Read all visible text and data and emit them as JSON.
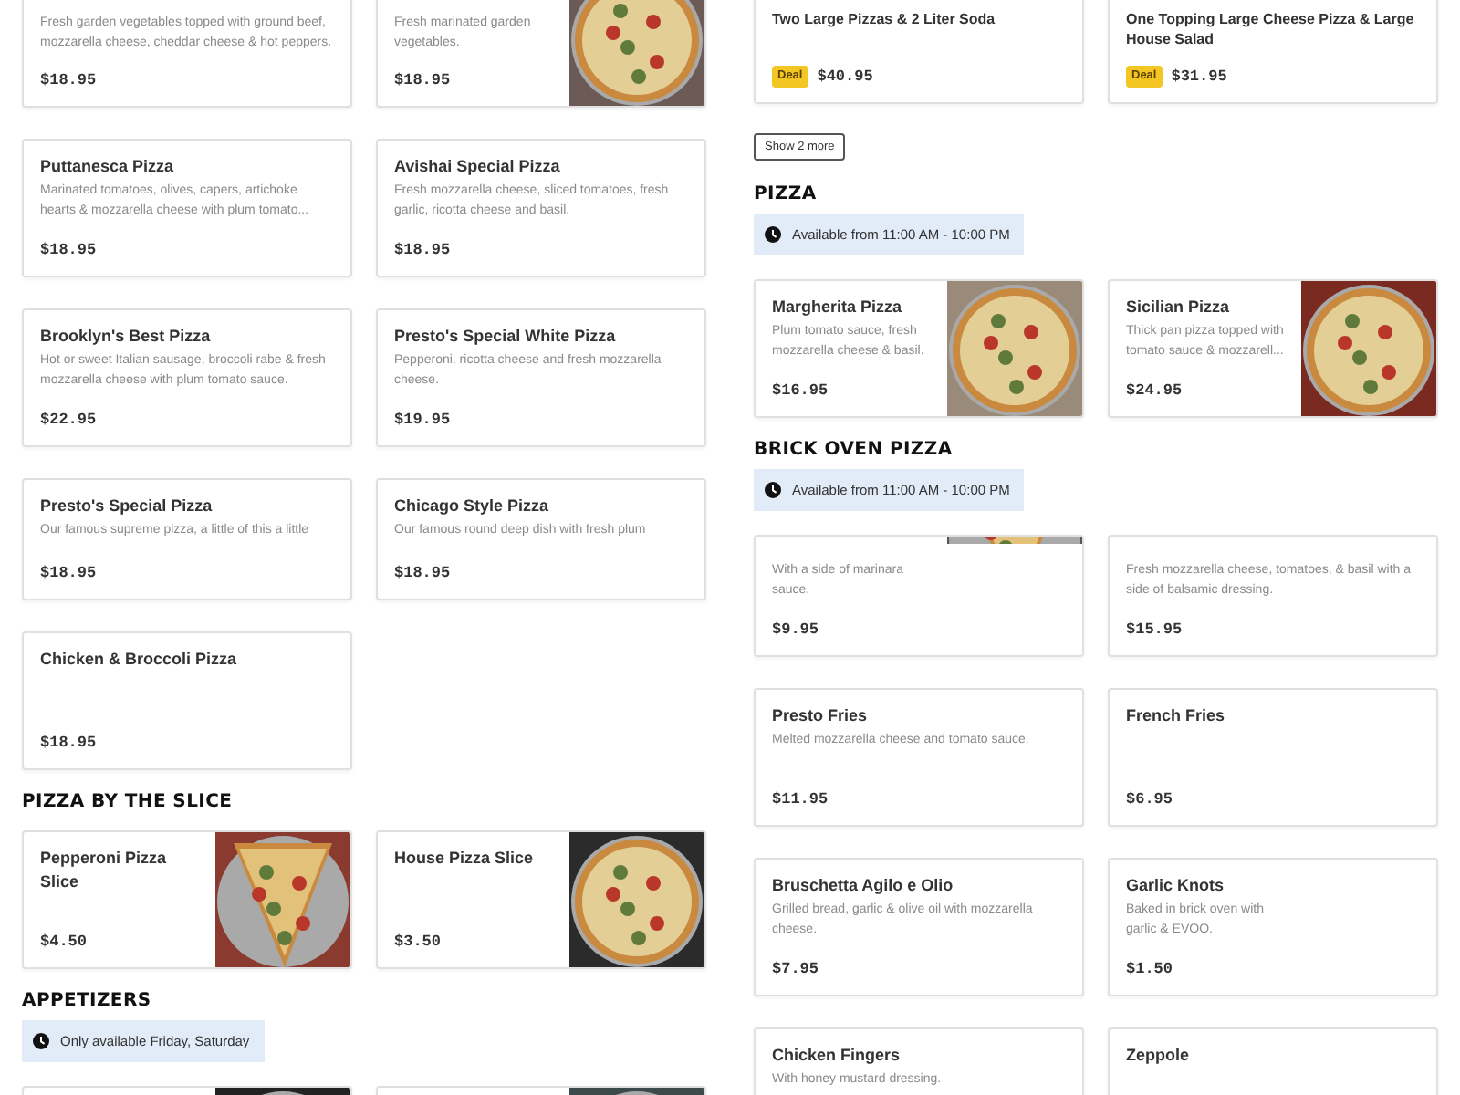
{
  "columns": [
    {
      "blocks": [
        {
          "kind": "top_cards",
          "items": [
            {
              "description": "Fresh garden vegetables topped with ground beef, mozzarella cheese, cheddar cheese & hot peppers.",
              "price": "$18.95"
            },
            {
              "description": "Fresh marinated garden vegetables.",
              "price": "$18.95"
            }
          ]
        },
        {
          "kind": "cards",
          "items": [
            {
              "title": "Puttanesca Pizza",
              "description": "Marinated tomatoes, olives, capers, artichoke hearts & mozzarella cheese with plum tomato...",
              "price": "$18.95"
            },
            {
              "title": "Avishai Special Pizza",
              "description": "Fresh mozzarella cheese, sliced tomatoes, fresh garlic, ricotta cheese and basil.",
              "price": "$18.95"
            }
          ]
        },
        {
          "kind": "cards",
          "items": [
            {
              "title": "Brooklyn's Best Pizza",
              "description": "Hot or sweet Italian sausage, broccoli rabe & fresh mozzarella cheese with plum tomato sauce.",
              "price": "$22.95"
            },
            {
              "title": "Presto's Special White Pizza",
              "description": "Pepperoni, ricotta cheese and fresh mozzarella cheese.",
              "price": "$19.95"
            }
          ]
        },
        {
          "kind": "short_cards",
          "items": [
            {
              "title": "Presto's Special Pizza",
              "description": "Our famous supreme pizza, a little of this a little",
              "price": "$18.95"
            },
            {
              "title": "Chicago Style Pizza",
              "description": "Our famous round deep dish with fresh plum",
              "price": "$18.95"
            }
          ]
        },
        {
          "kind": "cards",
          "items": [
            {
              "title": "Chicken & Broccoli Pizza",
              "price": "$18.95"
            }
          ]
        },
        {
          "kind": "heading",
          "text": "PIZZA BY THE SLICE"
        },
        {
          "kind": "cards",
          "items": [
            {
              "title": "Pepperoni Pizza Slice",
              "price": "$4.50"
            },
            {
              "title": "House Pizza Slice",
              "price": "$3.50"
            }
          ]
        },
        {
          "kind": "heading",
          "text": "APPETIZERS"
        },
        {
          "kind": "notice",
          "text": "Only available Friday, Saturday"
        },
        {
          "kind": "cards"
        }
      ]
    },
    {
      "blocks": [
        {
          "kind": "deal_cards",
          "items": [
            {
              "title": "Two Large Pizzas & 2 Liter Soda",
              "deal": "Deal",
              "price": "$40.95"
            },
            {
              "title": "One Topping Large Cheese Pizza & Large House Salad",
              "deal": "Deal",
              "price": "$31.95"
            }
          ]
        },
        {
          "kind": "button",
          "text": "Show 2 more"
        },
        {
          "kind": "heading",
          "text": "PIZZA"
        },
        {
          "kind": "notice",
          "text": "Available from 11:00 AM - 10:00 PM"
        },
        {
          "kind": "cards",
          "items": [
            {
              "title": "Margherita Pizza",
              "description": "Plum tomato sauce, fresh mozzarella cheese & basil.",
              "price": "$16.95"
            },
            {
              "title": "Sicilian Pizza",
              "description": "Thick pan pizza topped with tomato sauce & mozzarell...",
              "price": "$24.95"
            }
          ]
        },
        {
          "kind": "heading",
          "text": "BRICK OVEN PIZZA"
        },
        {
          "kind": "notice",
          "text": "Available from 11:00 AM - 10:00 PM"
        },
        {
          "kind": "cut_top_cards",
          "items": [
            {
              "description": "With a side of marinara\nsauce.",
              "price": "$9.95"
            },
            {
              "description": "Fresh mozzarella cheese, tomatoes, & basil with a side of balsamic dressing.",
              "price": "$15.95"
            }
          ]
        },
        {
          "kind": "cards",
          "items": [
            {
              "title": "Presto Fries",
              "description": "Melted mozzarella cheese and tomato sauce.",
              "price": "$11.95"
            },
            {
              "title": "French Fries",
              "price": "$6.95"
            }
          ]
        },
        {
          "kind": "cards",
          "items": [
            {
              "title": "Bruschetta Agilo e Olio",
              "description": "Grilled bread, garlic & olive oil with mozzarella cheese.",
              "price": "$7.95"
            },
            {
              "title": "Garlic Knots",
              "description": "Baked in brick oven with\ngarlic & EVOO.",
              "price": "$1.50"
            }
          ]
        },
        {
          "kind": "cards",
          "items": [
            {
              "title": "Chicken Fingers",
              "description": "With honey mustard dressing."
            },
            {
              "title": "Zeppole"
            }
          ]
        }
      ]
    }
  ]
}
